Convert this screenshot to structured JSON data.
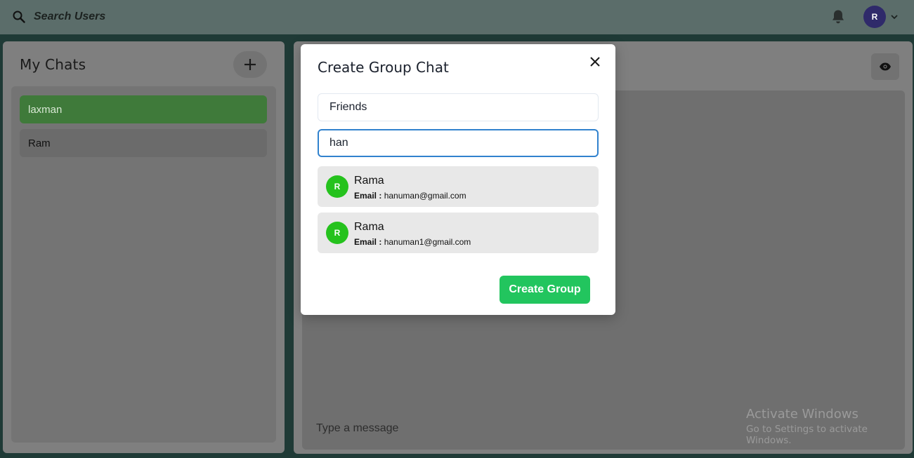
{
  "topbar": {
    "search_label": "Search Users",
    "search_icon": "search-icon",
    "bell_icon": "bell-icon",
    "avatar_initial": "R",
    "avatar_color": "#2f2a6a"
  },
  "chats_panel": {
    "title": "My Chats",
    "new_group_icon": "plus-icon",
    "items": [
      {
        "label": "laxman",
        "active": true
      },
      {
        "label": "Ram",
        "active": false
      }
    ]
  },
  "chat_window": {
    "eye_icon": "eye-icon",
    "message_placeholder": "Type a message"
  },
  "modal": {
    "title": "Create Group Chat",
    "group_name_value": "Friends",
    "search_value": "han",
    "results": [
      {
        "initial": "R",
        "name": "Rama",
        "email_label": "Email :",
        "email": "hanuman@gmail.com"
      },
      {
        "initial": "R",
        "name": "Rama",
        "email_label": "Email :",
        "email": "hanuman1@gmail.com"
      }
    ],
    "create_label": "Create Group",
    "accent_color": "#22c55e"
  },
  "watermark": {
    "line1": "Activate Windows",
    "line2": "Go to Settings to activate Windows."
  }
}
